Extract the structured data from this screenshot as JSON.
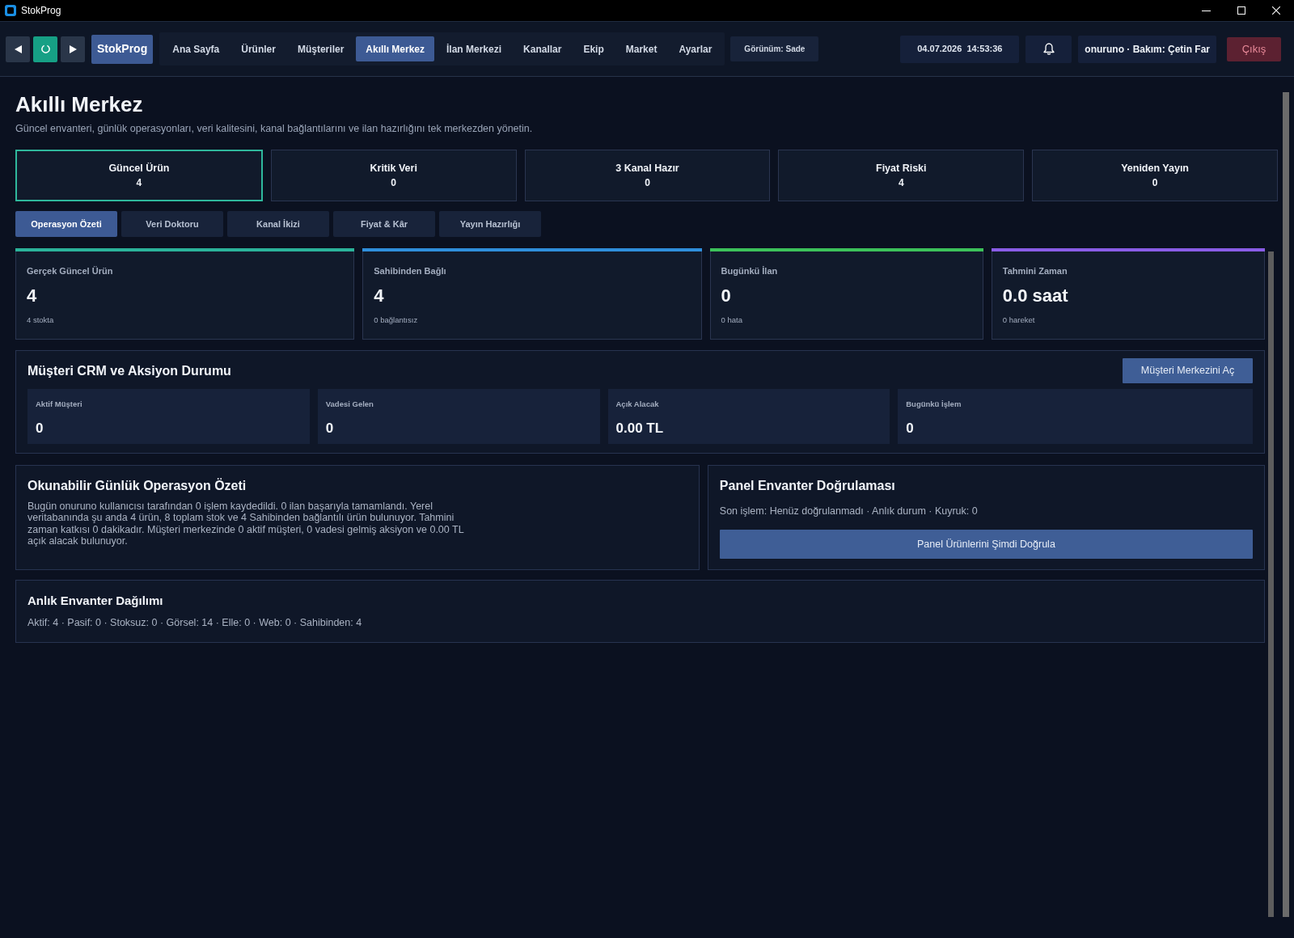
{
  "window": {
    "title": "StokProg"
  },
  "toolbar": {
    "brand": "StokProg",
    "menu": [
      {
        "label": "Ana Sayfa",
        "selected": false
      },
      {
        "label": "Ürünler",
        "selected": false
      },
      {
        "label": "Müşteriler",
        "selected": false
      },
      {
        "label": "Akıllı Merkez",
        "selected": true
      },
      {
        "label": "İlan Merkezi",
        "selected": false
      },
      {
        "label": "Kanallar",
        "selected": false
      },
      {
        "label": "Ekip",
        "selected": false
      },
      {
        "label": "Market",
        "selected": false
      },
      {
        "label": "Ayarlar",
        "selected": false
      }
    ],
    "view_mode": "Görünüm: Sade",
    "datetime": "04.07.2026  14:53:36",
    "user": "onuruno · Bakım: Çetin Far",
    "logout": "Çıkış"
  },
  "page": {
    "title": "Akıllı Merkez",
    "subtitle": "Güncel envanteri, günlük operasyonları, veri kalitesini, kanal bağlantılarını ve ilan hazırlığını tek merkezden yönetin."
  },
  "summary_cards": [
    {
      "label": "Güncel Ürün",
      "value": "4",
      "selected": true
    },
    {
      "label": "Kritik Veri",
      "value": "0",
      "selected": false
    },
    {
      "label": "3 Kanal Hazır",
      "value": "0",
      "selected": false
    },
    {
      "label": "Fiyat Riski",
      "value": "4",
      "selected": false
    },
    {
      "label": "Yeniden Yayın",
      "value": "0",
      "selected": false
    }
  ],
  "tabs": [
    {
      "label": "Operasyon Özeti",
      "selected": true
    },
    {
      "label": "Veri Doktoru",
      "selected": false
    },
    {
      "label": "Kanal İkizi",
      "selected": false
    },
    {
      "label": "Fiyat & Kâr",
      "selected": false
    },
    {
      "label": "Yayın Hazırlığı",
      "selected": false
    }
  ],
  "metrics": [
    {
      "label": "Gerçek Güncel Ürün",
      "value": "4",
      "note": "4 stokta",
      "color": "#2bb39a"
    },
    {
      "label": "Sahibinden Bağlı",
      "value": "4",
      "note": "0 bağlantısız",
      "color": "#2f8fdc"
    },
    {
      "label": "Bugünkü İlan",
      "value": "0",
      "note": "0 hata",
      "color": "#3cc25a"
    },
    {
      "label": "Tahmini Zaman",
      "value": "0.0 saat",
      "note": "0 hareket",
      "color": "#8a5ce6"
    }
  ],
  "crm": {
    "title": "Müşteri CRM ve Aksiyon Durumu",
    "button": "Müşteri Merkezini Aç",
    "tiles": [
      {
        "label": "Aktif Müşteri",
        "value": "0"
      },
      {
        "label": "Vadesi Gelen",
        "value": "0"
      },
      {
        "label": "Açık Alacak",
        "value": "0.00 TL"
      },
      {
        "label": "Bugünkü İşlem",
        "value": "0"
      }
    ]
  },
  "daily_summary": {
    "title": "Okunabilir Günlük Operasyon Özeti",
    "text": "Bugün onuruno kullanıcısı tarafından 0 işlem kaydedildi. 0 ilan başarıyla tamamlandı. Yerel veritabanında şu anda 4 ürün, 8 toplam stok ve 4 Sahibinden bağlantılı ürün bulunuyor. Tahmini zaman katkısı 0 dakikadır. Müşteri merkezinde 0 aktif müşteri, 0 vadesi gelmiş aksiyon ve 0.00 TL açık alacak bulunuyor."
  },
  "panel_verification": {
    "title": "Panel Envanter Doğrulaması",
    "status": "Son işlem: Henüz doğrulanmadı · Anlık durum · Kuyruk: 0",
    "button": "Panel Ürünlerini Şimdi Doğrula"
  },
  "inventory": {
    "title": "Anlık Envanter Dağılımı",
    "text": "Aktif: 4 · Pasif: 0 · Stoksuz: 0 · Görsel: 14 · Elle: 0 · Web: 0 · Sahibinden: 4"
  }
}
